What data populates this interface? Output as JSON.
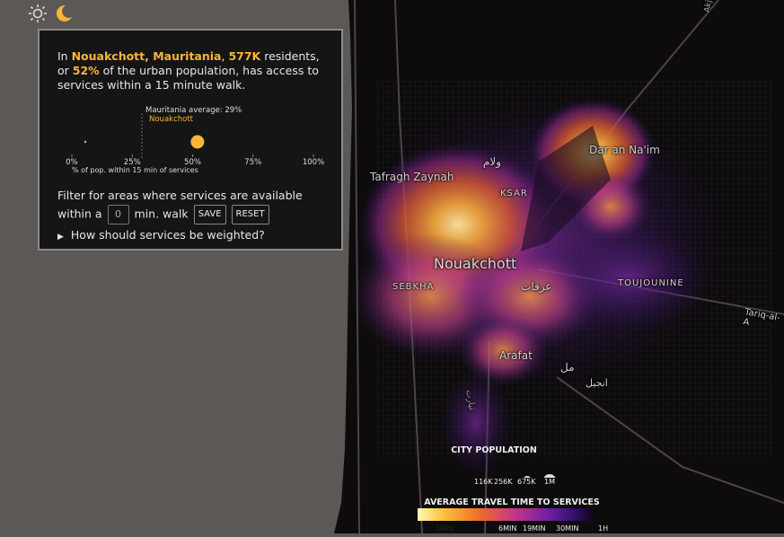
{
  "theme": {
    "light_icon": "sun-icon",
    "dark_icon": "moon-icon"
  },
  "summary": {
    "prefix": "In ",
    "city": "Nouakchott, Mauritania",
    "sep1": ", ",
    "residents": "577K",
    "mid": " residents, or ",
    "percent": "52%",
    "suffix": " of the urban population, has access to services within a 15 minute walk."
  },
  "mini_chart": {
    "national_label": "Mauritania average: 29%",
    "city_label": "Nouakchott",
    "axis_title": "% of pop. within 15 min of services",
    "ticks": [
      "0%",
      "25%",
      "50%",
      "75%",
      "100%"
    ],
    "national_value": 29,
    "city_value": 52
  },
  "filter": {
    "line1": "Filter for areas where services are available",
    "prefix": "within a",
    "value": "0",
    "suffix": "min. walk",
    "save_label": "SAVE",
    "reset_label": "RESET",
    "weighting": "How should services be weighted?"
  },
  "map_labels": {
    "city": "Nouakchott",
    "tafragh": "Tafragh Zaynah",
    "daran": "Dar an Na'im",
    "ksar": "KSAR",
    "sebkha": "SEBKHA",
    "toujounine": "TOUJOUNINE",
    "arafat": "Arafat",
    "tariq": "Tariq-al-A",
    "arabic_1": "ولام",
    "arabic_2": "عرفات",
    "arabic_3": "مل",
    "arabic_4": "تيارت",
    "arabic_5": "انجيل",
    "road_top": "Akj"
  },
  "legend": {
    "population_title": "CITY POPULATION",
    "population_labels": [
      "116K",
      "256K",
      "675K",
      "1M"
    ],
    "travel_title": "AVERAGE TRAVEL TIME TO SERVICES",
    "travel_labels": [
      "1MIN",
      "6MIN",
      "19MIN",
      "30MIN",
      "1H"
    ]
  },
  "colors": {
    "accent": "#f7b53a",
    "panel_bg": "#151515",
    "map_bg": "#0d0b0c",
    "land_bg": "#5b5855"
  }
}
